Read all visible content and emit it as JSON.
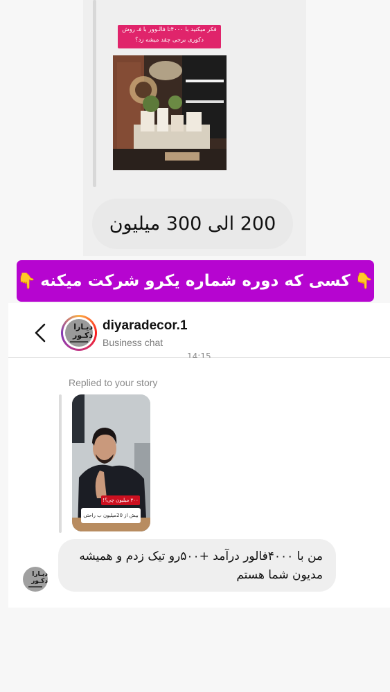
{
  "top_screenshot": {
    "story_caption": "فکر میکنید با ۴۰۰۰تا فالـوور با فـ روش دکوری برجی چقد میشه زد؟",
    "reply_message": "200 الی 300 میلیون"
  },
  "banner": {
    "text": "کسی که دوره شماره یکرو شرکت میکنه",
    "emoji": "👇"
  },
  "chat": {
    "header": {
      "username": "diyaradecor.1",
      "subtitle": "Business chat",
      "avatar_text": "دیـارا دکـور"
    },
    "timestamp": "14:15",
    "replied_label": "Replied to your story",
    "story": {
      "red_caption": "۳۰۰ میلیون چی؟!",
      "white_caption": "بیش از 20میلیون ب راحتی"
    },
    "message": "من با ۴۰۰۰فالور درآمد +۵۰۰رو تیک زدم و همیشه مدیون شما هستم"
  }
}
